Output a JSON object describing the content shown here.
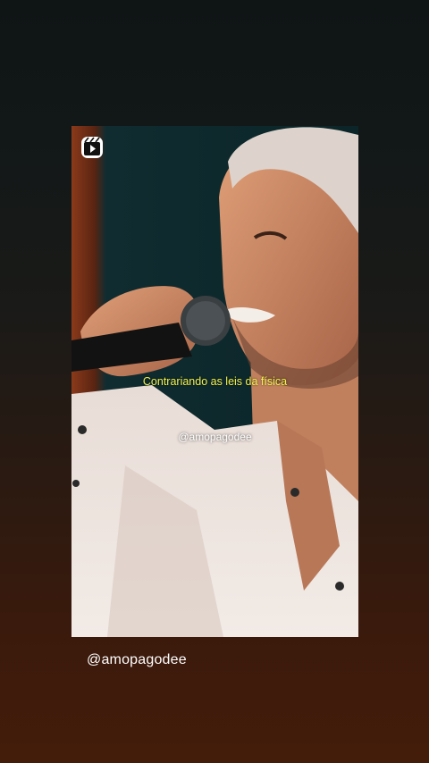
{
  "story": {
    "caption": "Contrariando as leis da física",
    "watermark": "@amopagodee",
    "handle": "@amopagodee",
    "media_icon": "reels-icon"
  },
  "colors": {
    "caption": "#f2f24a",
    "handle": "#ffffff"
  }
}
